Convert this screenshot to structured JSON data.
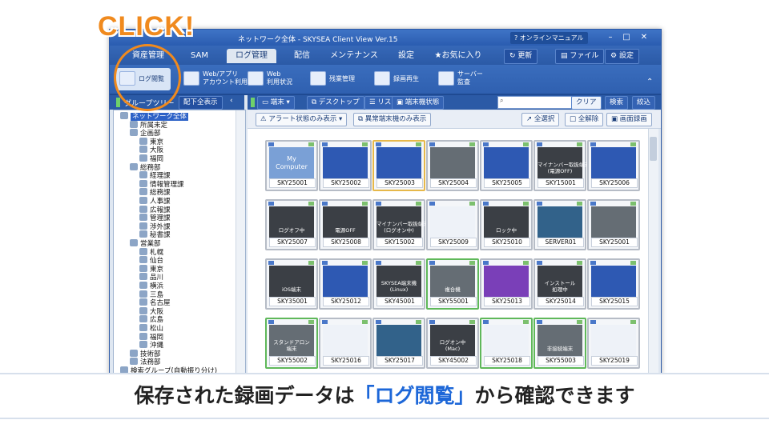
{
  "overlay": {
    "click_label": "CLICK!"
  },
  "window": {
    "title": "ネットワーク全体 - SKYSEA Client View Ver.15",
    "help_label": "オンラインマニュアル"
  },
  "menu": {
    "tabs": [
      "資産管理",
      "SAM",
      "ログ管理",
      "配信",
      "メンテナンス",
      "設定",
      "お気に入り"
    ],
    "active": "ログ管理",
    "refresh": "更新",
    "file": "ファイル",
    "settings": "設定"
  },
  "ribbon": {
    "buttons": [
      "ログ閲覧",
      "Web/アプリ\nアカウント利用状況",
      "Web\n利用状況",
      "残業管理",
      "録画再生",
      "サーバー\n監査"
    ]
  },
  "leftpanel": {
    "title": "グループツリー",
    "show_sub": "配下全表示"
  },
  "toolbar": {
    "terminal": "端末",
    "desktop": "デスクトップ",
    "list": "リスト",
    "terminal_state": "端末機状態",
    "clear": "クリア",
    "search": "検索",
    "filter": "絞込",
    "alert_only": "アラート状態のみ表示",
    "abnormal_only": "異常端末機のみ表示",
    "select_all": "全選択",
    "deselect_all": "全解除",
    "screen_record": "画面録画"
  },
  "tree": [
    {
      "label": "ネットワーク全体",
      "depth": 0,
      "selected": true
    },
    {
      "label": "所属未定",
      "depth": 1
    },
    {
      "label": "企画部",
      "depth": 1
    },
    {
      "label": "東京",
      "depth": 2
    },
    {
      "label": "大阪",
      "depth": 2
    },
    {
      "label": "福岡",
      "depth": 2
    },
    {
      "label": "総務部",
      "depth": 1
    },
    {
      "label": "経理課",
      "depth": 2
    },
    {
      "label": "情報管理課",
      "depth": 2
    },
    {
      "label": "総務課",
      "depth": 2
    },
    {
      "label": "人事課",
      "depth": 2
    },
    {
      "label": "広報課",
      "depth": 2
    },
    {
      "label": "管理課",
      "depth": 2
    },
    {
      "label": "渉外課",
      "depth": 2
    },
    {
      "label": "秘書課",
      "depth": 2
    },
    {
      "label": "営業部",
      "depth": 1
    },
    {
      "label": "札幌",
      "depth": 2
    },
    {
      "label": "仙台",
      "depth": 2
    },
    {
      "label": "東京",
      "depth": 2
    },
    {
      "label": "品川",
      "depth": 2
    },
    {
      "label": "横浜",
      "depth": 2
    },
    {
      "label": "三島",
      "depth": 2
    },
    {
      "label": "名古屋",
      "depth": 2
    },
    {
      "label": "大阪",
      "depth": 2
    },
    {
      "label": "広島",
      "depth": 2
    },
    {
      "label": "松山",
      "depth": 2
    },
    {
      "label": "福岡",
      "depth": 2
    },
    {
      "label": "沖縄",
      "depth": 2
    },
    {
      "label": "技術部",
      "depth": 1
    },
    {
      "label": "法務部",
      "depth": 1
    },
    {
      "label": "検索グループ(自動振り分け)",
      "depth": 0
    }
  ],
  "tiles": [
    {
      "name": "SKY25001",
      "screen": "mycomp",
      "text": "My\nComputer",
      "border": "normal"
    },
    {
      "name": "SKY25002",
      "screen": "blue",
      "text": "",
      "border": "normal"
    },
    {
      "name": "SKY25003",
      "screen": "blue",
      "text": "",
      "border": "yellow"
    },
    {
      "name": "SKY25004",
      "screen": "gray",
      "text": "",
      "border": "normal"
    },
    {
      "name": "SKY25005",
      "screen": "blue",
      "text": "",
      "border": "normal"
    },
    {
      "name": "SKY15001",
      "screen": "dark",
      "text": "マイナンバー取扱端末\n(電源OFF)",
      "border": "normal"
    },
    {
      "name": "SKY25006",
      "screen": "blue",
      "text": "",
      "border": "normal"
    },
    {
      "name": "SKY25007",
      "screen": "dark",
      "text": "ログオフ中",
      "border": "normal"
    },
    {
      "name": "SKY25008",
      "screen": "dark",
      "text": "電源OFF",
      "border": "normal"
    },
    {
      "name": "SKY15002",
      "screen": "dark",
      "text": "マイナンバー取扱端末\n(ログオン中)",
      "border": "normal"
    },
    {
      "name": "SKY25009",
      "screen": "light",
      "text": "",
      "border": "normal"
    },
    {
      "name": "SKY25010",
      "screen": "dark",
      "text": "ロック中",
      "border": "normal"
    },
    {
      "name": "SERVER01",
      "screen": "teal",
      "text": "",
      "border": "normal"
    },
    {
      "name": "SKY25001",
      "screen": "gray",
      "text": "",
      "border": "normal"
    },
    {
      "name": "SKY35001",
      "screen": "dark",
      "text": "iOS端末",
      "border": "normal"
    },
    {
      "name": "SKY25012",
      "screen": "blue",
      "text": "",
      "border": "normal"
    },
    {
      "name": "SKY45001",
      "screen": "dark",
      "text": "SKYSEA端末機\n(Linux)",
      "border": "normal"
    },
    {
      "name": "SKY55001",
      "screen": "gray",
      "text": "複合機",
      "border": "green"
    },
    {
      "name": "SKY25013",
      "screen": "purple",
      "text": "",
      "border": "normal"
    },
    {
      "name": "SKY25014",
      "screen": "dark",
      "text": "インストール\n処理中",
      "border": "normal"
    },
    {
      "name": "SKY25015",
      "screen": "blue",
      "text": "",
      "border": "normal"
    },
    {
      "name": "SKY55002",
      "screen": "gray",
      "text": "スタンドアロン\n端末",
      "border": "green"
    },
    {
      "name": "SKY25016",
      "screen": "light",
      "text": "",
      "border": "normal"
    },
    {
      "name": "SKY25017",
      "screen": "teal",
      "text": "",
      "border": "normal"
    },
    {
      "name": "SKY45002",
      "screen": "dark",
      "text": "ログオン中\n(Mac)",
      "border": "normal"
    },
    {
      "name": "SKY25018",
      "screen": "light",
      "text": "",
      "border": "green"
    },
    {
      "name": "SKY55003",
      "screen": "gray",
      "text": "非接続端末",
      "border": "green"
    },
    {
      "name": "SKY25019",
      "screen": "light",
      "text": "",
      "border": "normal"
    }
  ],
  "caption": {
    "before": "保存された録画データは",
    "highlight": "「ログ閲覧」",
    "after": "から確認できます"
  }
}
